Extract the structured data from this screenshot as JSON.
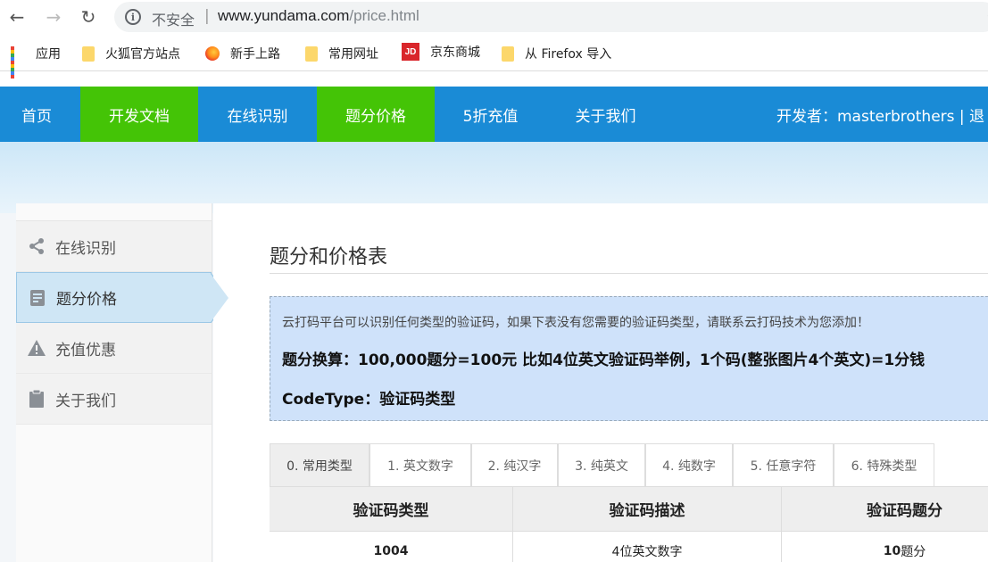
{
  "browser": {
    "insecure_label": "不安全",
    "separator": "|",
    "url_host": "www.yundama.com",
    "url_path": "/price.html"
  },
  "bookmarks": [
    {
      "label": "应用",
      "icon": "apps-grid-icon"
    },
    {
      "label": "火狐官方站点",
      "icon": "folder-icon"
    },
    {
      "label": "新手上路",
      "icon": "firefox-icon"
    },
    {
      "label": "常用网址",
      "icon": "folder-icon"
    },
    {
      "label": "京东商城",
      "icon": "jd-icon",
      "icon_text": "JD"
    },
    {
      "label": "从 Firefox 导入",
      "icon": "folder-icon"
    }
  ],
  "nav": {
    "items": [
      "首页",
      "开发文档",
      "在线识别",
      "题分价格",
      "5折充值",
      "关于我们"
    ],
    "developer": "开发者：masterbrothers  |  退"
  },
  "sidebar": {
    "items": [
      {
        "label": "在线识别",
        "icon": "share-icon"
      },
      {
        "label": "题分价格",
        "icon": "document-icon"
      },
      {
        "label": "充值优惠",
        "icon": "warning-icon"
      },
      {
        "label": "关于我们",
        "icon": "clipboard-icon"
      }
    ]
  },
  "content": {
    "title": "题分和价格表",
    "info_line1": "云打码平台可以识别任何类型的验证码，如果下表没有您需要的验证码类型，请联系云打码技术为您添加！",
    "info_line2": "题分换算：100,000题分=100元 比如4位英文验证码举例，1个码(整张图片4个英文)=1分钱",
    "info_line3": "CodeType：验证码类型"
  },
  "tabs": [
    "0. 常用类型",
    "1. 英文数字",
    "2. 纯汉字",
    "3. 纯英文",
    "4. 纯数字",
    "5. 任意字符",
    "6. 特殊类型"
  ],
  "table": {
    "headers": [
      "验证码类型",
      "验证码描述",
      "验证码题分"
    ],
    "rows": [
      {
        "type": "1004",
        "desc": "4位英文数字",
        "score_num": "10",
        "score_unit": "题分"
      }
    ]
  },
  "colors": {
    "nav_blue": "#1a8bd6",
    "nav_green": "#44c406",
    "info_bg": "#cfe2fa"
  }
}
